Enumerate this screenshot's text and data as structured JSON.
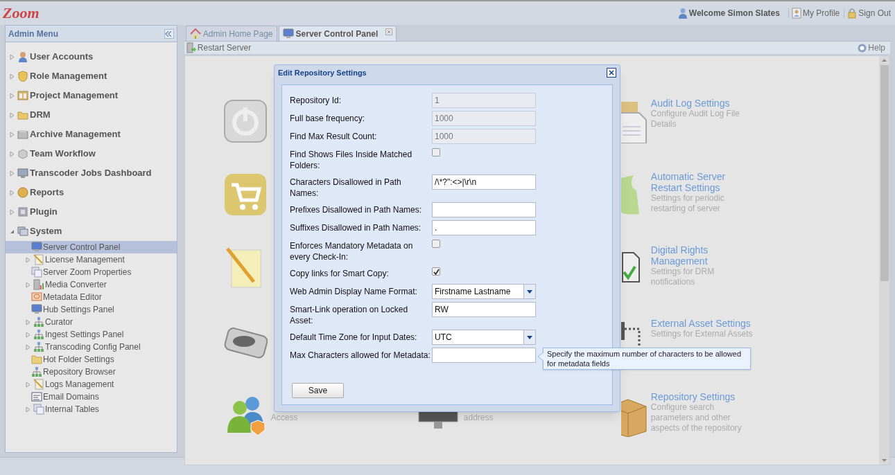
{
  "header": {
    "logo": "Zoom",
    "welcome": "Welcome Simon Slates",
    "links": [
      "My Profile",
      "Sign Out"
    ]
  },
  "sidebar": {
    "title": "Admin Menu",
    "items": [
      {
        "label": "User Accounts",
        "expanded": false
      },
      {
        "label": "Role Management",
        "expanded": false
      },
      {
        "label": "Project Management",
        "expanded": false
      },
      {
        "label": "DRM",
        "expanded": false
      },
      {
        "label": "Archive Management",
        "expanded": false
      },
      {
        "label": "Team Workflow",
        "expanded": false
      },
      {
        "label": "Transcoder Jobs Dashboard",
        "expanded": false
      },
      {
        "label": "Reports",
        "expanded": false
      },
      {
        "label": "Plugin",
        "expanded": false
      },
      {
        "label": "System",
        "expanded": true,
        "children": [
          {
            "label": "Server Control Panel",
            "selected": true,
            "expandable": false
          },
          {
            "label": "License Management",
            "selected": false,
            "expandable": true
          },
          {
            "label": "Server Zoom Properties",
            "selected": false,
            "expandable": false
          },
          {
            "label": "Media Converter",
            "selected": false,
            "expandable": true
          },
          {
            "label": "Metadata Editor",
            "selected": false,
            "expandable": false
          },
          {
            "label": "Hub Settings Panel",
            "selected": false,
            "expandable": false
          },
          {
            "label": "Curator",
            "selected": false,
            "expandable": true
          },
          {
            "label": "Ingest Settings Panel",
            "selected": false,
            "expandable": true
          },
          {
            "label": "Transcoding Config Panel",
            "selected": false,
            "expandable": true
          },
          {
            "label": "Hot Folder Settings",
            "selected": false,
            "expandable": false
          },
          {
            "label": "Repository Browser",
            "selected": false,
            "expandable": false
          },
          {
            "label": "Logs Management",
            "selected": false,
            "expandable": true
          },
          {
            "label": "Email Domains",
            "selected": false,
            "expandable": false
          },
          {
            "label": "Internal Tables",
            "selected": false,
            "expandable": true
          }
        ]
      }
    ]
  },
  "tabs": [
    {
      "label": "Admin Home Page",
      "selected": false,
      "closable": false
    },
    {
      "label": "Server Control Panel",
      "selected": true,
      "closable": true
    }
  ],
  "toolbar": {
    "buttons": [
      "Restart Server"
    ],
    "help": "Help"
  },
  "settings_grid": {
    "columns": [
      [
        {},
        {},
        {},
        {},
        {
          "description_lines": [
            "Access"
          ]
        }
      ],
      [
        {},
        {},
        {},
        {},
        {
          "description_lines": [
            "address"
          ]
        }
      ],
      [
        {
          "title_lines": [
            "Audit Log Settings"
          ],
          "description_lines": [
            "Configure Audit Log File",
            "Details"
          ]
        },
        {
          "title_lines": [
            "Automatic Server",
            "Restart Settings"
          ],
          "description_lines": [
            "Settings for periodic",
            "restarting of server"
          ]
        },
        {
          "title_lines": [
            "Digital Rights",
            "Management"
          ],
          "description_lines": [
            "Settings for DRM",
            "notifications"
          ]
        },
        {
          "title_lines": [
            "External Asset Settings"
          ],
          "description_lines": [
            "Settings for External Assets"
          ]
        },
        {
          "title_lines": [
            "Repository Settings"
          ],
          "description_lines": [
            "Configure search",
            "parameters and other",
            "aspects of the repository"
          ]
        }
      ]
    ]
  },
  "dialog": {
    "title": "Edit Repository Settings",
    "fields": [
      {
        "label": "Repository Id:",
        "kind": "text",
        "value": "1",
        "disabled": true
      },
      {
        "label": "Full base frequency:",
        "kind": "text",
        "value": "1000",
        "disabled": true
      },
      {
        "label": "Find Max Result Count:",
        "kind": "text",
        "value": "1000",
        "disabled": true
      },
      {
        "label": "Find Shows Files Inside Matched Folders:",
        "kind": "checkbox",
        "checked": false
      },
      {
        "label": "Characters Disallowed in Path Names:",
        "kind": "text",
        "value": "/\\*?\":<>|\\r\\n",
        "disabled": false
      },
      {
        "label": "Prefixes Disallowed in Path Names:",
        "kind": "text",
        "disabled": false
      },
      {
        "label": "Suffixes Disallowed in Path Names:",
        "kind": "text",
        "value": ".",
        "disabled": false
      },
      {
        "label": "Enforces Mandatory Metadata on every Check-In:",
        "kind": "checkbox",
        "checked": false
      },
      {
        "label": "Copy links for Smart Copy:",
        "kind": "checkbox",
        "checked": true
      },
      {
        "label": "Web Admin Display Name Format:",
        "kind": "select",
        "value": "Firstname Lastname"
      },
      {
        "label": "Smart-Link operation on Locked Asset:",
        "kind": "text",
        "value": "RW",
        "disabled": false
      },
      {
        "label": "Default Time Zone for Input Dates:",
        "kind": "select",
        "value": "UTC"
      },
      {
        "label": "Max Characters allowed for Metadata:",
        "kind": "text",
        "disabled": false,
        "tooltip": "Specify the maximum number of characters to be allowed for metadata fields"
      }
    ],
    "buttons": [
      "Save"
    ]
  }
}
